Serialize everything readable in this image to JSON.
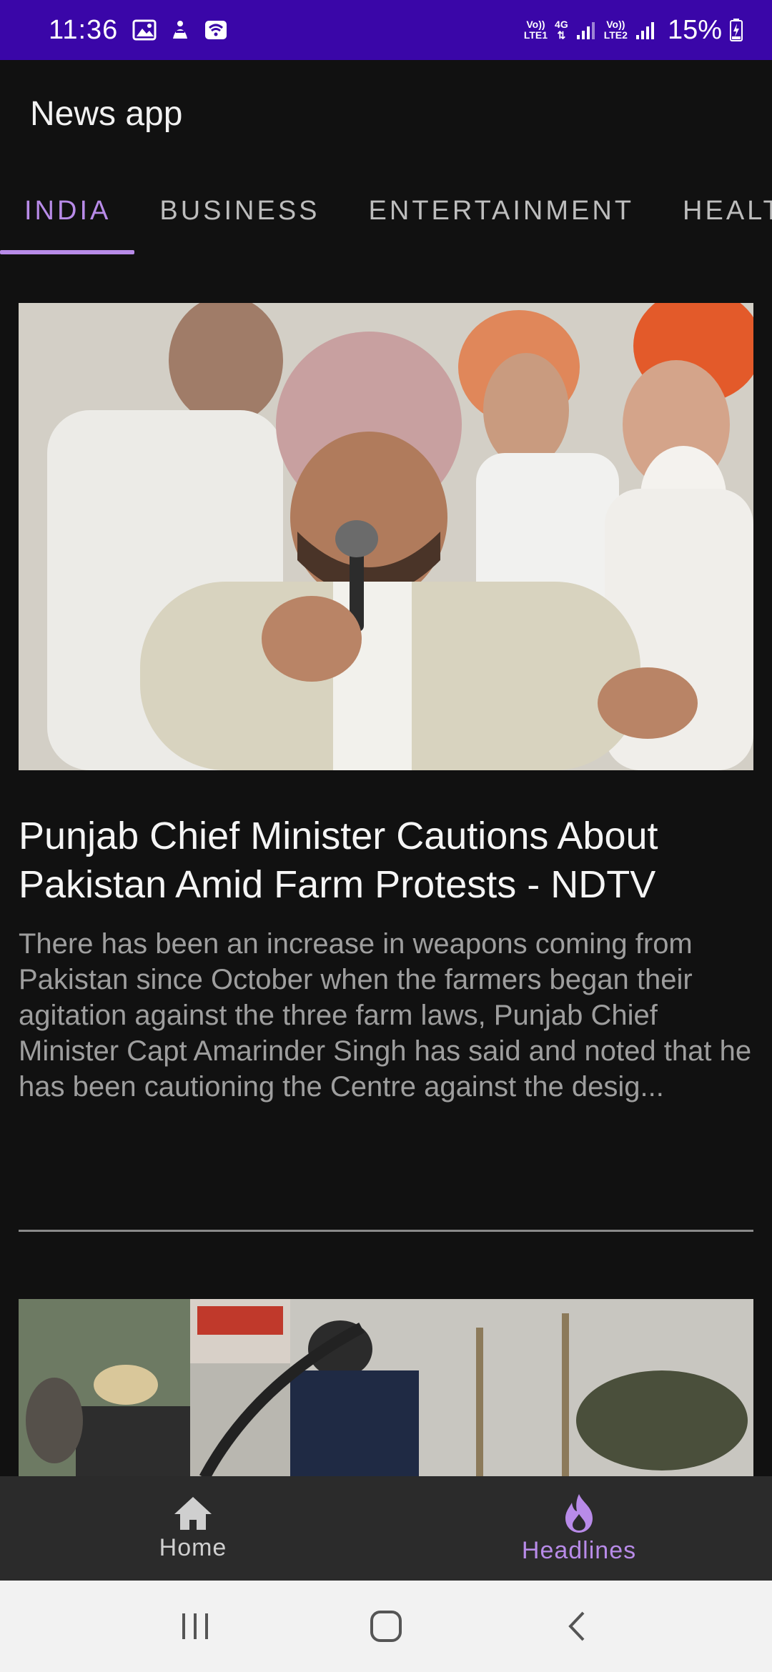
{
  "status_bar": {
    "time": "11:36",
    "left_icons": [
      "image-icon",
      "accessibility-icon",
      "wifi-calling-icon"
    ],
    "sim1_label_top": "Vo))",
    "sim1_label_bottom": "LTE1",
    "network_type": "4G",
    "sim2_label_top": "Vo))",
    "sim2_label_bottom": "LTE2",
    "battery": "15%",
    "bar_color": "#3a06a8"
  },
  "app_bar": {
    "title": "News app"
  },
  "tabs": [
    {
      "label": "INDIA",
      "active": true
    },
    {
      "label": "BUSINESS",
      "active": false
    },
    {
      "label": "ENTERTAINMENT",
      "active": false
    },
    {
      "label": "HEALTH",
      "active": false
    }
  ],
  "articles": [
    {
      "title": "Punjab Chief Minister Cautions About Pakistan Amid Farm Protests - NDTV",
      "description": "There has been an increase in weapons coming from Pakistan since October when the farmers began their agitation against the three farm laws, Punjab Chief Minister Capt Amarinder Singh has said and noted that he has been cautioning the Centre against the desig..."
    }
  ],
  "bottom_nav": {
    "items": [
      {
        "label": "Home",
        "icon": "home-icon",
        "active": false
      },
      {
        "label": "Headlines",
        "icon": "fire-icon",
        "active": true
      }
    ]
  },
  "accent_color": "#b88be8",
  "background_color": "#111111"
}
